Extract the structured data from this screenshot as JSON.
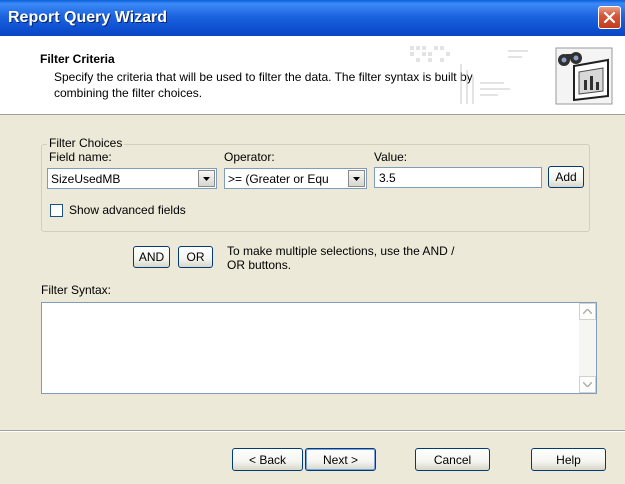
{
  "window": {
    "title": "Report Query Wizard"
  },
  "header": {
    "title": "Filter Criteria",
    "description": "Specify the criteria that will be used to filter the data. The filter syntax is built by combining the filter choices."
  },
  "filter_choices": {
    "legend": "Filter Choices",
    "field_name_label": "Field name:",
    "field_name_value": "SizeUsedMB",
    "operator_label": "Operator:",
    "operator_value": ">=  (Greater or Equ",
    "value_label": "Value:",
    "value_value": "3.5",
    "add_label": "Add",
    "show_advanced_label": "Show advanced fields",
    "show_advanced_checked": false
  },
  "logic": {
    "and_label": "AND",
    "or_label": "OR",
    "hint": "To make multiple selections, use the AND / OR buttons."
  },
  "syntax": {
    "label": "Filter Syntax:",
    "value": ""
  },
  "footer": {
    "back_label": "< Back",
    "next_label": "Next >",
    "cancel_label": "Cancel",
    "help_label": "Help"
  },
  "icons": [
    "close-icon",
    "wizard-binoculars-icon",
    "dropdown-arrow-icon",
    "scroll-up-icon",
    "scroll-down-icon"
  ],
  "colors": {
    "titlebar": "#0a5fd8",
    "dialog": "#ece9d8",
    "border": "#7f9db9",
    "button_border": "#003c74"
  }
}
